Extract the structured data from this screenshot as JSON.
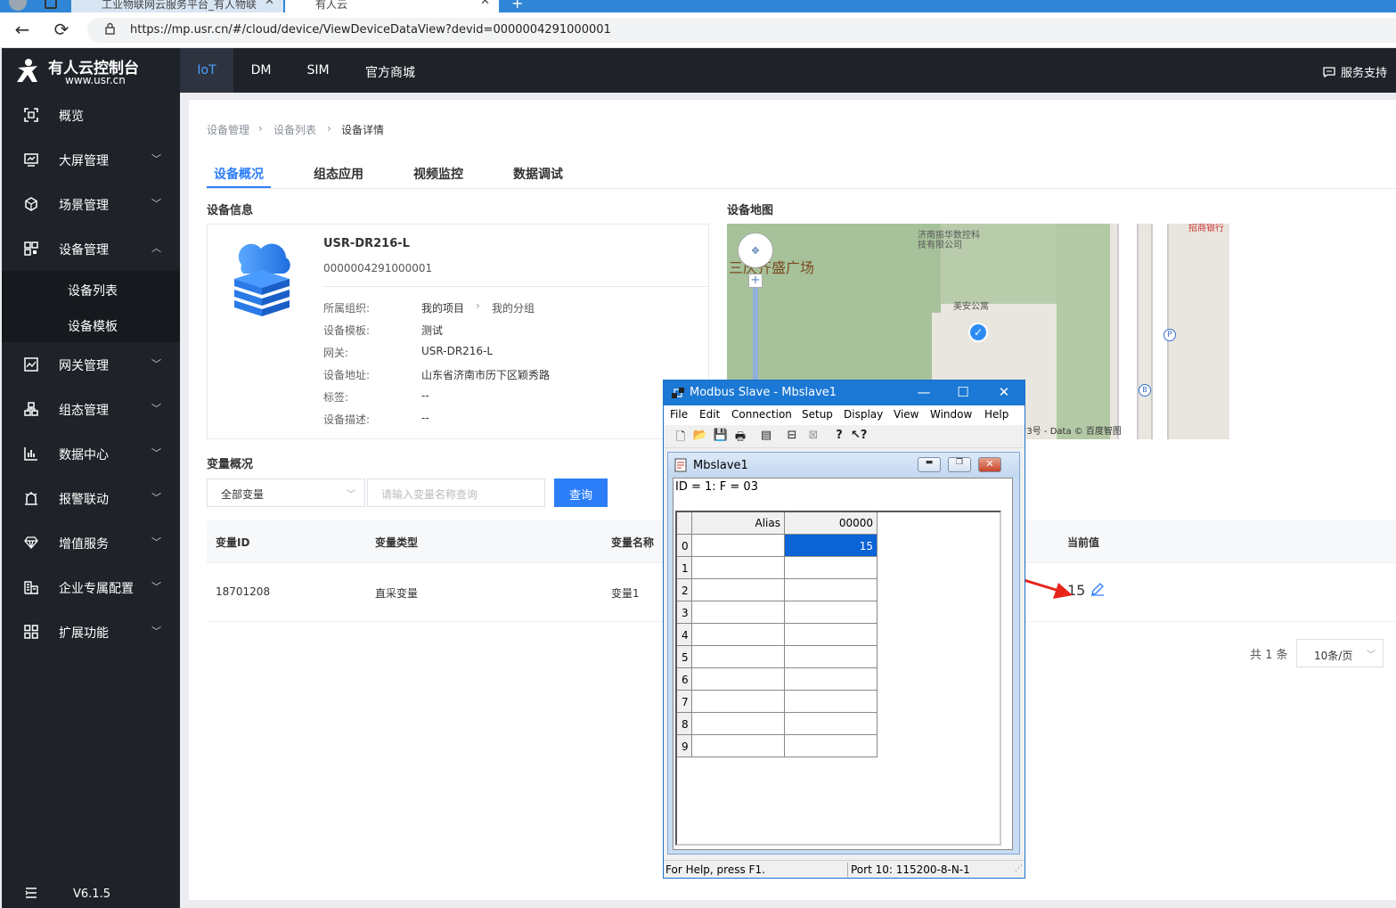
{
  "browser": {
    "tabs": [
      {
        "label": "工业物联网云服务平台_有人物联"
      },
      {
        "label": "有人云"
      }
    ],
    "url": "https://mp.usr.cn/#/cloud/device/ViewDeviceDataView?devid=0000004291000001"
  },
  "brand": {
    "title": "有人云控制台",
    "site": "www.usr.cn"
  },
  "topnav": {
    "items": [
      "IoT",
      "DM",
      "SIM",
      "官方商城"
    ],
    "support": "服务支持"
  },
  "sidebar": {
    "items": [
      {
        "label": "概览",
        "icon": "overview-icon"
      },
      {
        "label": "大屏管理",
        "icon": "screen-icon"
      },
      {
        "label": "场景管理",
        "icon": "scene-icon"
      },
      {
        "label": "设备管理",
        "icon": "device-icon"
      },
      {
        "label": "网关管理",
        "icon": "gateway-icon"
      },
      {
        "label": "组态管理",
        "icon": "config-icon"
      },
      {
        "label": "数据中心",
        "icon": "data-icon"
      },
      {
        "label": "报警联动",
        "icon": "alarm-icon"
      },
      {
        "label": "增值服务",
        "icon": "diamond-icon"
      },
      {
        "label": "企业专属配置",
        "icon": "enterprise-icon"
      },
      {
        "label": "扩展功能",
        "icon": "grid-icon"
      }
    ],
    "subitems": [
      "设备列表",
      "设备模板"
    ],
    "version": "V6.1.5"
  },
  "breadcrumb": [
    "设备管理",
    "设备列表",
    "设备详情"
  ],
  "tabs": [
    "设备概况",
    "组态应用",
    "视频监控",
    "数据调试"
  ],
  "device_info": {
    "section_title": "设备信息",
    "name": "USR-DR216-L",
    "id": "0000004291000001",
    "fields": [
      {
        "key": "所属组织:",
        "value": "我的项目",
        "value2": "我的分组"
      },
      {
        "key": "设备模板:",
        "value": "测试"
      },
      {
        "key": "网关:",
        "value": "USR-DR216-L"
      },
      {
        "key": "设备地址:",
        "value": "山东省济南市历下区颖秀路"
      },
      {
        "key": "标签:",
        "value": "--"
      },
      {
        "key": "设备描述:",
        "value": "--"
      }
    ]
  },
  "device_map": {
    "section_title": "设备地图",
    "labels": {
      "plaza": "三庆齐盛广场",
      "company": "济南振华数控科技有限公司",
      "apartment": "美安公寓",
      "bank": "招商银行",
      "copyright": "73号 - Data © 百度智图"
    }
  },
  "variables": {
    "section_title": "变量概况",
    "filter_value": "全部变量",
    "search_placeholder": "请输入变量名称查询",
    "query_button": "查询",
    "columns": [
      "变量ID",
      "变量类型",
      "变量名称",
      "当前值"
    ],
    "rows": [
      {
        "id": "18701208",
        "type": "直采变量",
        "name": "变量1",
        "value": "15"
      }
    ],
    "total": "共 1 条",
    "page_size": "10条/页"
  },
  "modbus": {
    "window_title": "Modbus Slave - Mbslave1",
    "menu": [
      "File",
      "Edit",
      "Connection",
      "Setup",
      "Display",
      "View",
      "Window",
      "Help"
    ],
    "child_title": "Mbslave1",
    "id_line": "ID = 1: F = 03",
    "col_alias": "Alias",
    "col_addr": "00000",
    "rows": [
      "0",
      "1",
      "2",
      "3",
      "4",
      "5",
      "6",
      "7",
      "8",
      "9"
    ],
    "values": [
      "15",
      "",
      "",
      "",
      "",
      "",
      "",
      "",
      "",
      ""
    ],
    "status_left": "For Help, press F1.",
    "status_right": "Port 10: 115200-8-N-1"
  },
  "colors": {
    "sidebar_bg": "#1f2329",
    "accent": "#2c7ef8",
    "titlebar": "#1b78d4",
    "selected_cell": "#0a64d6",
    "arrow": "#e8251b"
  }
}
